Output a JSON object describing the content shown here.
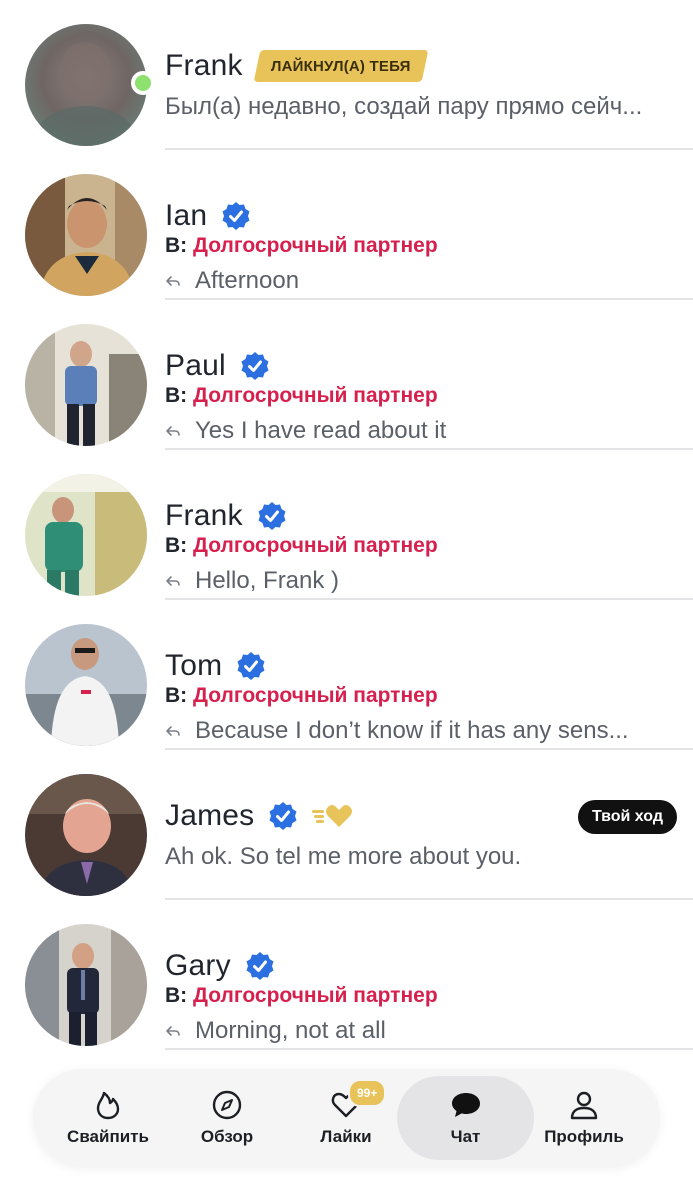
{
  "chats": [
    {
      "name": "Frank",
      "badge": "ЛАЙКНУЛ(А) ТЕБЯ",
      "message": "Был(а) недавно, создай пару прямо сейч...",
      "online": true
    },
    {
      "name": "Ian",
      "seeking_prefix": "В:",
      "seeking_goal": "Долгосрочный партнер",
      "message": "Afternoon"
    },
    {
      "name": "Paul",
      "seeking_prefix": "В:",
      "seeking_goal": "Долгосрочный партнер",
      "message": "Yes I have read about it"
    },
    {
      "name": "Frank",
      "seeking_prefix": "В:",
      "seeking_goal": "Долгосрочный партнер",
      "message": "Hello, Frank )"
    },
    {
      "name": "Tom",
      "seeking_prefix": "В:",
      "seeking_goal": "Долгосрочный партнер",
      "message": "Because I don’t know if it has any sens..."
    },
    {
      "name": "James",
      "turn_badge": "Твой ход",
      "message": "Ah ok.  So tel me more about you."
    },
    {
      "name": "Gary",
      "seeking_prefix": "В:",
      "seeking_goal": "Долгосрочный партнер",
      "message": "Morning, not at all"
    }
  ],
  "nav": {
    "swipe": "Свайпить",
    "explore": "Обзор",
    "likes": "Лайки",
    "likes_count": "99+",
    "chat": "Чат",
    "profile": "Профиль",
    "active": "chat"
  },
  "colors": {
    "accent_pink": "#d6204e",
    "verified_blue": "#2b6fe0",
    "gold": "#e8c35a",
    "online_green": "#8ee06f"
  }
}
